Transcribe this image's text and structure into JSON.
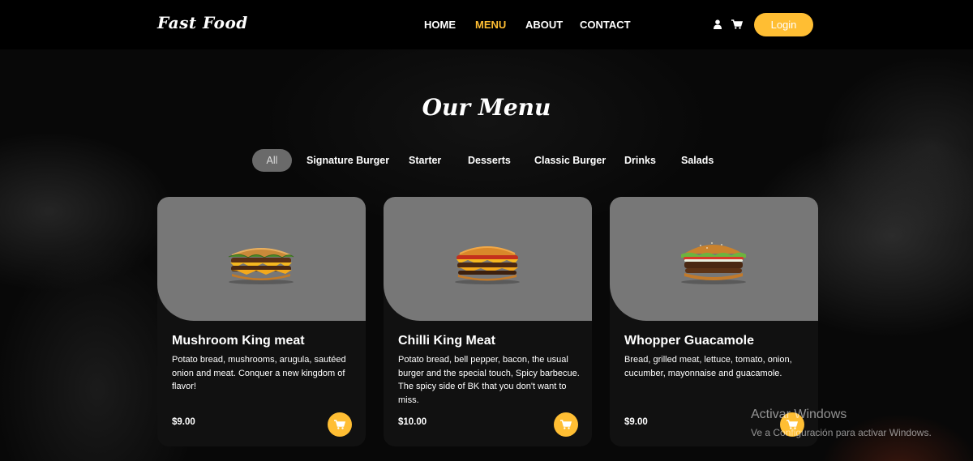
{
  "header": {
    "logo": "Fast Food",
    "nav": [
      "HOME",
      "MENU",
      "ABOUT",
      "CONTACT"
    ],
    "active_nav": "MENU",
    "login_label": "Login",
    "icons": [
      "user-icon",
      "cart-icon"
    ]
  },
  "main": {
    "title": "Our Menu",
    "filters": [
      "All",
      "Signature Burger",
      "Starter",
      "Desserts",
      "Classic Burger",
      "Drinks",
      "Salads"
    ],
    "active_filter": "All",
    "cards": [
      {
        "name": "Mushroom King meat",
        "description": "Potato bread, mushrooms, arugula, sautéed onion and meat. Conquer a new kingdom of flavor!",
        "price": "$9.00"
      },
      {
        "name": "Chilli King Meat",
        "description": "Potato bread, bell pepper, bacon, the usual burger and the special touch, Spicy barbecue. The spicy side of BK that you don't want to miss.",
        "price": "$10.00"
      },
      {
        "name": "Whopper Guacamole",
        "description": "Bread, grilled meat, lettuce, tomato, onion, cucumber, mayonnaise and guacamole.",
        "price": "$9.00"
      }
    ]
  },
  "watermark": {
    "title": "Activar Windows",
    "subtitle": "Ve a Configuración para activar Windows."
  },
  "colors": {
    "accent": "#ffbe33",
    "background": "#000000",
    "card": "#111111",
    "card_image": "#777777"
  }
}
